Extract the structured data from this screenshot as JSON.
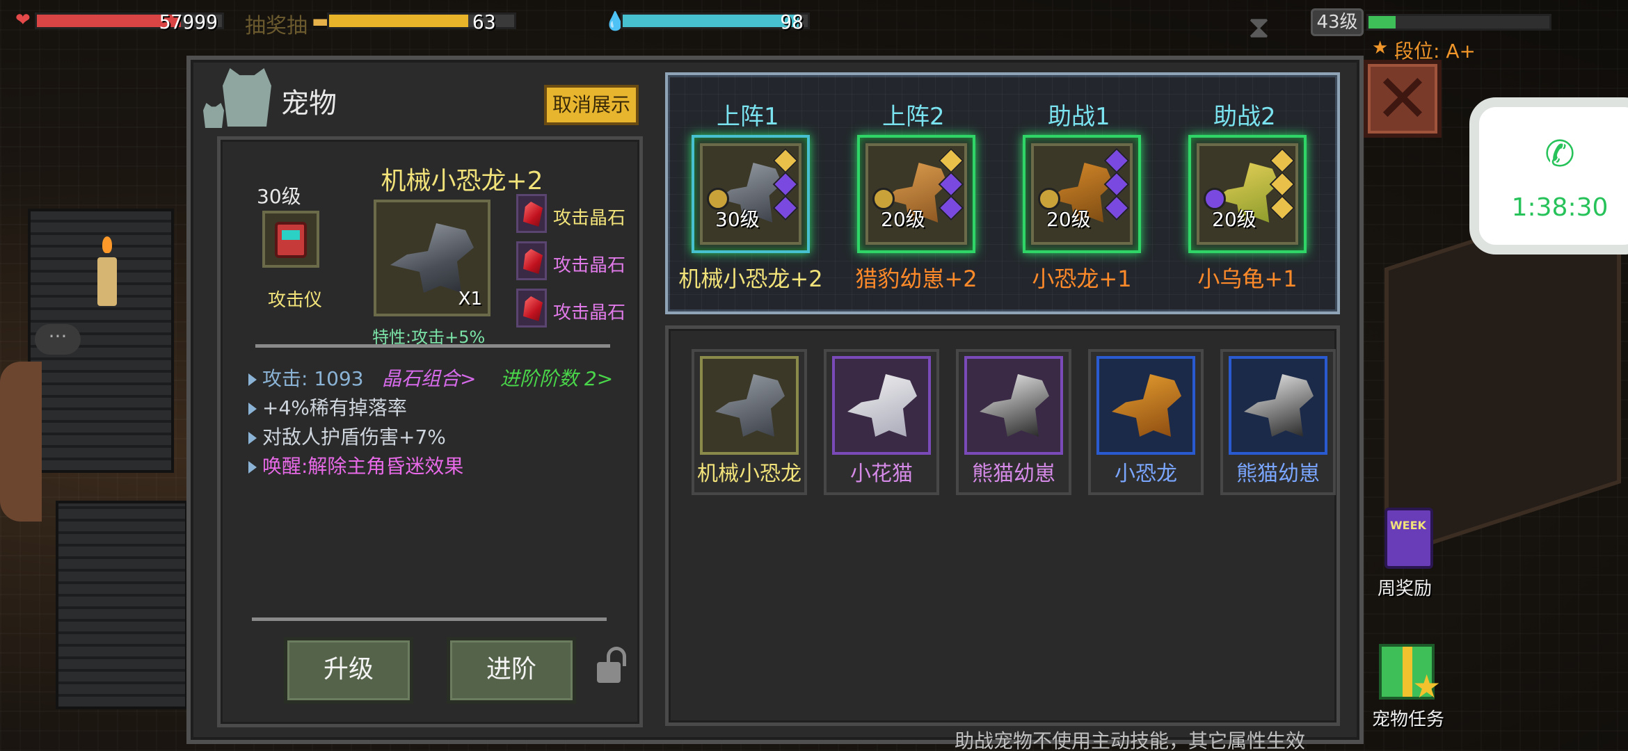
{
  "hud": {
    "hp": "57999",
    "hp_fraction": 0.78,
    "faded_text": "抽奖抽",
    "energy": "63",
    "energy_fraction": 0.75,
    "mana": "98",
    "mana_fraction": 0.95,
    "level": "43级",
    "exp_fraction": 0.15,
    "rank": "段位: A+"
  },
  "call": {
    "timer": "1:38:30"
  },
  "panel": {
    "title": "宠物",
    "cancel_display": "取消展示",
    "close_icon": "close-icon",
    "footer_note": "助战宠物不使用主动技能，其它属性生效"
  },
  "detail": {
    "pet_name": "机械小恐龙+2",
    "level": "30级",
    "equipment_label": "攻击仪",
    "count": "X1",
    "trait": "特性:攻击+5%",
    "gems": [
      "攻击晶石",
      "攻击晶石",
      "攻击晶石"
    ],
    "stats": {
      "attack": "攻击: 1093",
      "gem_combo": "晶石组合>",
      "advance": "进阶阶数 2>",
      "drop": "+4%稀有掉落率",
      "shield": "对敌人护盾伤害+7%",
      "awaken": "唤醒:解除主角昏迷效果"
    },
    "upgrade_btn": "升级",
    "advance_btn": "进阶"
  },
  "team": [
    {
      "slot": "上阵1",
      "level": "30级",
      "name": "机械小恐龙+2",
      "name_color": "#f2e27a",
      "selected": true
    },
    {
      "slot": "上阵2",
      "level": "20级",
      "name": "猎豹幼崽+2",
      "name_color": "#ff8a2a",
      "selected": false
    },
    {
      "slot": "助战1",
      "level": "20级",
      "name": "小恐龙+1",
      "name_color": "#ff8a2a",
      "selected": false
    },
    {
      "slot": "助战2",
      "level": "20级",
      "name": "小乌龟+1",
      "name_color": "#ff8a2a",
      "selected": false
    }
  ],
  "inventory": [
    {
      "name": "机械小恐龙",
      "color": "#f2e27a",
      "rarity": "gold"
    },
    {
      "name": "小花猫",
      "color": "#d58ae8",
      "rarity": "purple"
    },
    {
      "name": "熊猫幼崽",
      "color": "#d58ae8",
      "rarity": "purple"
    },
    {
      "name": "小恐龙",
      "color": "#7aa6ff",
      "rarity": "blue"
    },
    {
      "name": "熊猫幼崽",
      "color": "#7aa6ff",
      "rarity": "blue"
    }
  ],
  "side": {
    "weekly_reward": "周奖励",
    "week_badge": "WEEK",
    "pet_task": "宠物任务"
  },
  "colors": {
    "accent_green": "#2fd567",
    "gold_text": "#f2e27a",
    "orange_text": "#ff8a2a",
    "cyan_text": "#7be3f0"
  }
}
